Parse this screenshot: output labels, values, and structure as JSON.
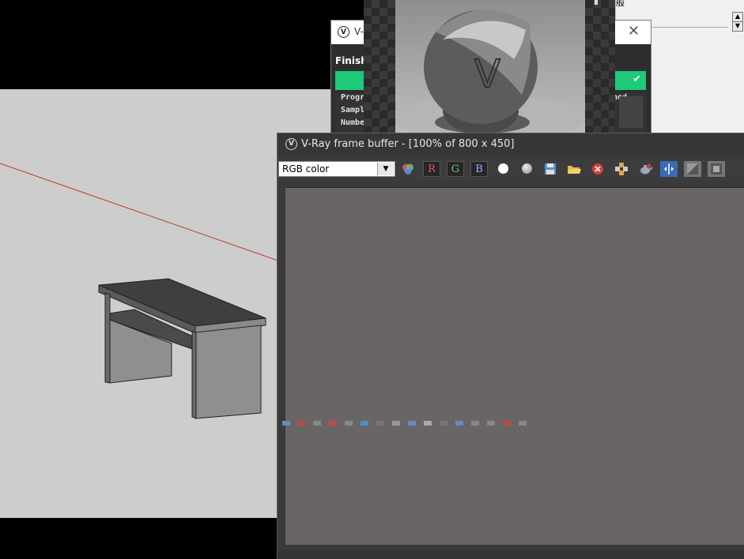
{
  "side_panel": {
    "label": "般",
    "scroll_up": "▲",
    "scroll_down": "▼"
  },
  "progress_dialog": {
    "title": "V-",
    "status": "Finishe",
    "log_lines": [
      "Progr",
      "Sampl",
      "Numbe"
    ],
    "log_right": "ned",
    "close_glyph": "✕",
    "check_glyph": "✔",
    "accent": "#1ec97a"
  },
  "vfb": {
    "logo": "V",
    "title": "V-Ray frame buffer - [100% of 800 x 450]",
    "channel": "RGB color",
    "channel_arrow": "▼",
    "buttons": {
      "r": "R",
      "g": "G",
      "b": "B"
    },
    "colors": {
      "canvas": "#686564",
      "red": "#e85a5a",
      "green": "#6fbf6f",
      "blue": "#8fb4ff"
    }
  },
  "icons": [
    "color-correction-icon",
    "white-circle-icon",
    "gray-circle-icon",
    "save-icon",
    "open-folder-icon",
    "clear-icon",
    "region-render-icon",
    "teapot-render-icon",
    "compare-icon",
    "image-a-icon",
    "image-b-icon"
  ]
}
